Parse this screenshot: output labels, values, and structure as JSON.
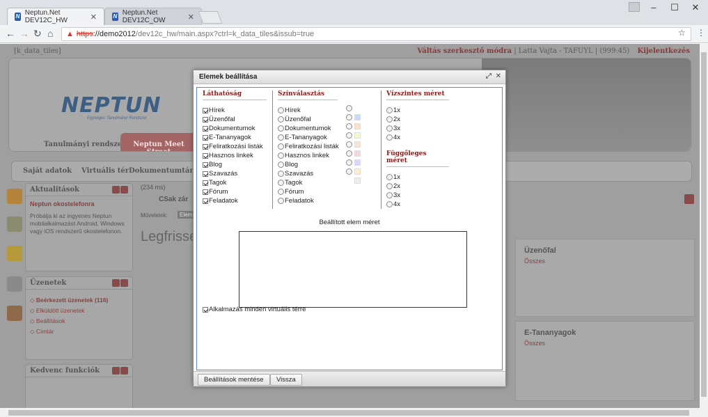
{
  "browser": {
    "tabs": [
      {
        "title": "Neptun.Net DEV12C_HW",
        "active": true
      },
      {
        "title": "Neptun.Net DEV12C_OW",
        "active": false
      }
    ],
    "url": {
      "scheme": "https",
      "rest_host": "://demo2012",
      "rest_path": "/dev12c_hw/main.aspx?ctrl=k_data_tiles&issub=true"
    }
  },
  "page": {
    "control_label": "[k_data_tiles]",
    "top_right": {
      "edit_mode": "Váltás szerkesztő módra",
      "user": "Latta Vajta - TAFUYL",
      "timer": "(999:45)",
      "logout": "Kijelentkezés"
    },
    "logo": "NEPTUN",
    "logo_sub": "Egységes Tanulmányi Rendszer",
    "nav_tabs": [
      "Tanulmányi rendszer",
      "Neptun Meet Street"
    ],
    "menu": [
      "Saját adatok",
      "Virtuális tér",
      "Dokumentumtár"
    ],
    "panels": {
      "news": {
        "title": "Aktualitások",
        "headline": "Neptun okostelefonra",
        "text": "Próbálja ki az ingyenes Neptun mobilalkalmazást Android, Windows vagy iOS rendszerű okostelefonon."
      },
      "messages": {
        "title": "Üzenetek",
        "items": [
          "Beérkezett üzenetek (116)",
          "Elküldött üzenetek",
          "Beállítások",
          "Címtár"
        ]
      },
      "favorites": {
        "title": "Kedvenc funkciók"
      }
    },
    "content": {
      "timing": "(234 ms)",
      "only_closed": "CSak zár",
      "actions_label": "Műveletek:",
      "actions_btn": "Elem",
      "heading": "Legfrisse"
    },
    "tiles": [
      {
        "title": "Üzenőfal",
        "link": "Összes"
      },
      {
        "title": "E-Tananyagok",
        "link": "Összes"
      }
    ]
  },
  "modal": {
    "title": "Elemek beállítása",
    "visibility": {
      "header": "Láthatóság",
      "items": [
        {
          "label": "Hírek",
          "checked": true
        },
        {
          "label": "Üzenőfal",
          "checked": true
        },
        {
          "label": "Dokumentumok",
          "checked": true
        },
        {
          "label": "E-Tananyagok",
          "checked": true
        },
        {
          "label": "Feliratkozási listák",
          "checked": true
        },
        {
          "label": "Hasznos linkek",
          "checked": true
        },
        {
          "label": "Blog",
          "checked": true
        },
        {
          "label": "Szavazás",
          "checked": true
        },
        {
          "label": "Tagok",
          "checked": true
        },
        {
          "label": "Fórum",
          "checked": true
        },
        {
          "label": "Feladatok",
          "checked": true
        }
      ]
    },
    "colors": {
      "header": "Színválasztás",
      "items": [
        "Hírek",
        "Üzenőfal",
        "Dokumentumok",
        "E-Tananyagok",
        "Feliratkozási listák",
        "Hasznos linkek",
        "Blog",
        "Szavazás",
        "Tagok",
        "Fórum",
        "Feladatok"
      ],
      "swatches": [
        "#ccd9ff",
        "#f6e3c9",
        "#f7f9d2",
        "#f9e3d9",
        "#f6d5e6",
        "#dcd6fb",
        "#fdf0c9",
        "#eeeeee"
      ]
    },
    "hsize": {
      "header": "Vízszintes méret",
      "options": [
        "1x",
        "2x",
        "3x",
        "4x"
      ]
    },
    "vsize": {
      "header": "Függőleges méret",
      "options": [
        "1x",
        "2x",
        "3x",
        "4x"
      ]
    },
    "preview_label": "Beállított elem méret",
    "apply_all": {
      "label": "Alkalmazás minden virtuális térre",
      "checked": true
    },
    "buttons": {
      "save": "Beállítások mentése",
      "back": "Vissza"
    }
  }
}
